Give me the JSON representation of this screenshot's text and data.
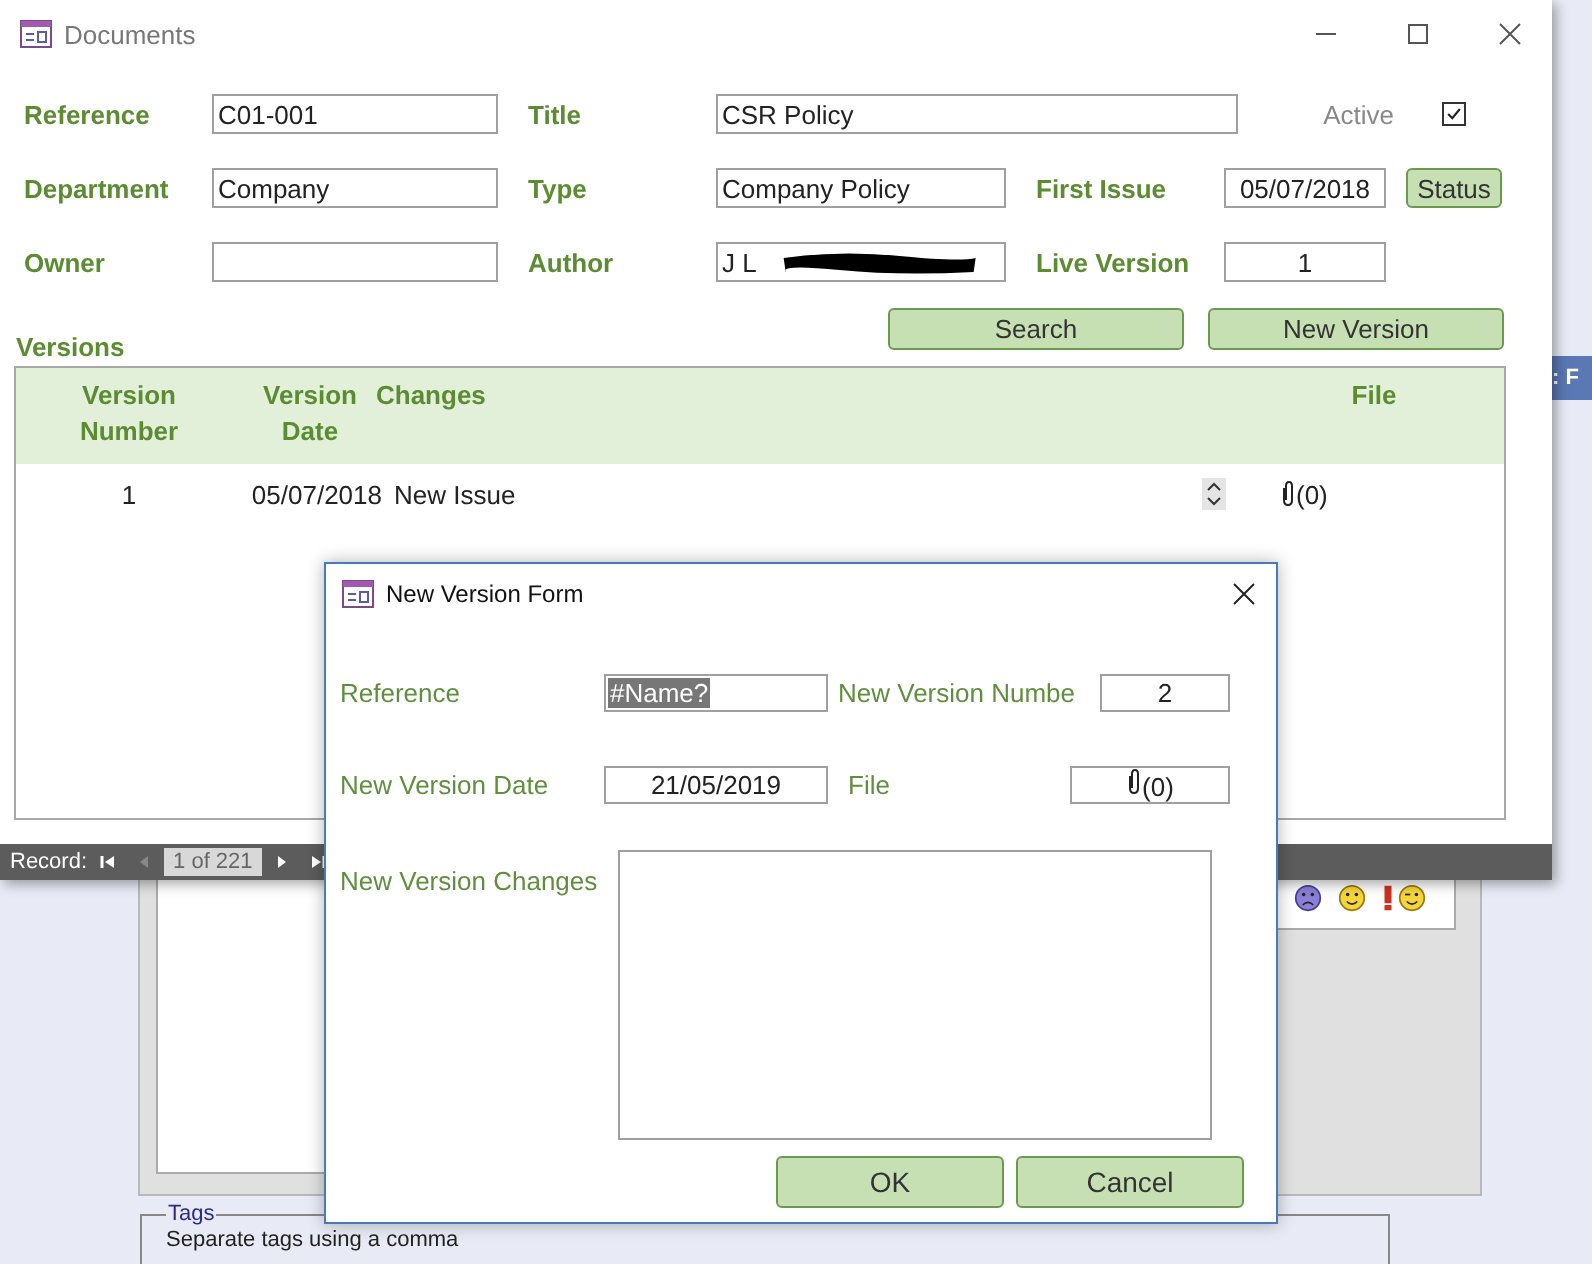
{
  "background": {
    "side_tab": ": F",
    "tags": {
      "legend": "Tags",
      "hint": "Separate tags using a comma"
    }
  },
  "main_window": {
    "title": "Documents"
  },
  "fields": [
    {
      "label": "Reference",
      "value": "C01-001"
    },
    {
      "label": "Title",
      "value": "CSR Policy"
    },
    {
      "label": "Department",
      "value": "Company"
    },
    {
      "label": "Type",
      "value": "Company Policy"
    },
    {
      "label": "First Issue",
      "value": "05/07/2018"
    },
    {
      "label": "Owner"
    },
    {
      "label": "Author",
      "value": "J L",
      "redacted": true
    },
    {
      "label": "Live Version",
      "value": "1"
    }
  ],
  "active": {
    "label": "Active",
    "checked": true
  },
  "status_button": "Status",
  "versions": {
    "title": "Versions",
    "buttons": [
      "Search",
      "New Version"
    ],
    "columns": [
      "Version Number",
      "Version Date",
      "Changes",
      "File"
    ],
    "rows": [
      {
        "number": "1",
        "date": "05/07/2018",
        "changes": "New Issue",
        "file": "(0)"
      }
    ]
  },
  "record_nav": {
    "label": "Record:",
    "position": "1 of 221"
  },
  "dialog": {
    "title": "New Version Form",
    "fields": [
      {
        "label": "Reference",
        "value": "#Name?",
        "selected": true
      },
      {
        "label": "New Version Numbe",
        "value": "2",
        "selected": false
      },
      {
        "label": "New Version Date",
        "value": "21/05/2019",
        "selected": false
      },
      {
        "label": "File",
        "value": "(0)",
        "kind": "attachment",
        "selected": false
      }
    ],
    "changes_label": "New Version Changes",
    "buttons": [
      "OK",
      "Cancel"
    ]
  }
}
